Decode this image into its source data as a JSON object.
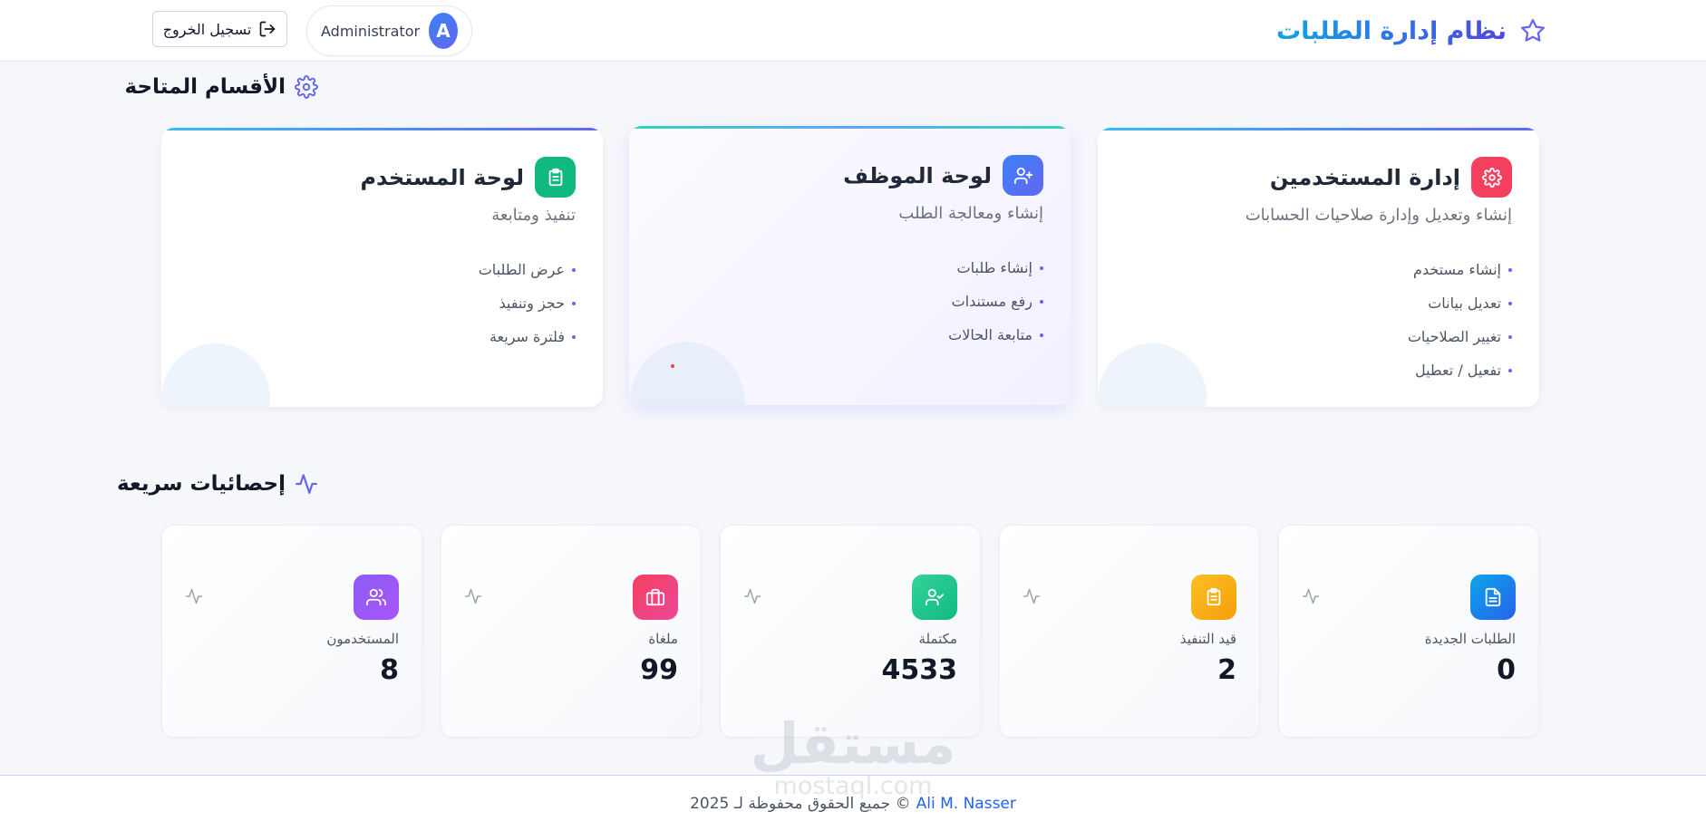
{
  "header": {
    "app_title": "نظام إدارة الطلبات",
    "user_name": "Administrator",
    "avatar_letter": "A",
    "logout_label": "تسجيل الخروج"
  },
  "sections": {
    "title": "الأقسام المتاحة",
    "cards": [
      {
        "title": "إدارة المستخدمين",
        "subtitle": "إنشاء وتعديل وإدارة صلاحيات الحسابات",
        "icon": "gear-icon",
        "color": "#f43f5e",
        "items": [
          "إنشاء مستخدم",
          "تعديل بيانات",
          "تغيير الصلاحيات",
          "تفعيل / تعطيل"
        ]
      },
      {
        "title": "لوحة الموظف",
        "subtitle": "إنشاء ومعالجة الطلب",
        "icon": "user-plus-icon",
        "color": "#3b82f6",
        "items": [
          "إنشاء طلبات",
          "رفع مستندات",
          "متابعة الحالات"
        ]
      },
      {
        "title": "لوحة المستخدم",
        "subtitle": "تنفيذ ومتابعة",
        "icon": "clipboard-icon",
        "color": "#10b981",
        "items": [
          "عرض الطلبات",
          "حجز وتنفيذ",
          "فلترة سريعة"
        ]
      }
    ]
  },
  "stats": {
    "title": "إحصائيات سريعة",
    "items": [
      {
        "label": "الطلبات الجديدة",
        "value": "0",
        "icon": "document-icon",
        "color": "#0ea5e9"
      },
      {
        "label": "قيد التنفيذ",
        "value": "2",
        "icon": "clipboard-icon",
        "color": "#f59e0b"
      },
      {
        "label": "مكتملة",
        "value": "4533",
        "icon": "user-check-icon",
        "color": "#10b981"
      },
      {
        "label": "ملغاة",
        "value": "99",
        "icon": "briefcase-icon",
        "color": "#ec4899"
      },
      {
        "label": "المستخدمون",
        "value": "8",
        "icon": "users-icon",
        "color": "#8b5cf6"
      }
    ]
  },
  "footer": {
    "author": "Ali M. Nasser",
    "rights": "جميع الحقوق محفوظة لـ 2025 ©"
  },
  "watermark": {
    "arabic": "مستقل",
    "english": "mostaql.com"
  }
}
